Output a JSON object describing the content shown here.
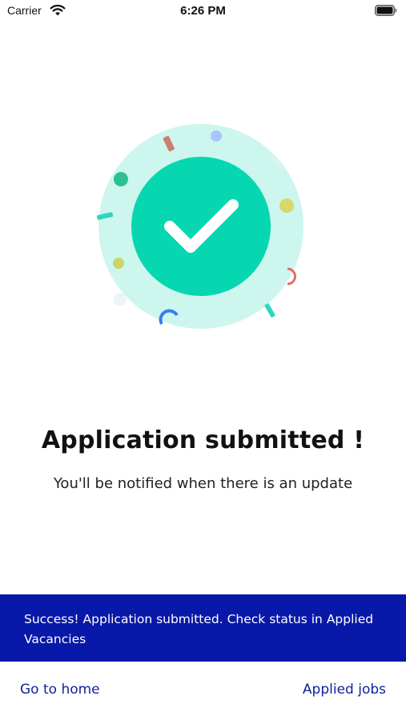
{
  "status_bar": {
    "carrier": "Carrier",
    "time": "6:26 PM"
  },
  "icons": {
    "wifi": "wifi-icon",
    "battery": "battery-icon",
    "success": "check-icon"
  },
  "colors": {
    "accent_circle": "#06d7b0",
    "halo": "#cdf6ee",
    "snackbar_bg": "#0818a8",
    "link": "#10229c"
  },
  "main": {
    "title": "Application submitted !",
    "subtitle": "You'll be notified when there is an update"
  },
  "snackbar": {
    "message": "Success! Application submitted. Check status in Applied Vacancies"
  },
  "footer": {
    "home_label": "Go to home",
    "applied_label": "Applied jobs"
  }
}
